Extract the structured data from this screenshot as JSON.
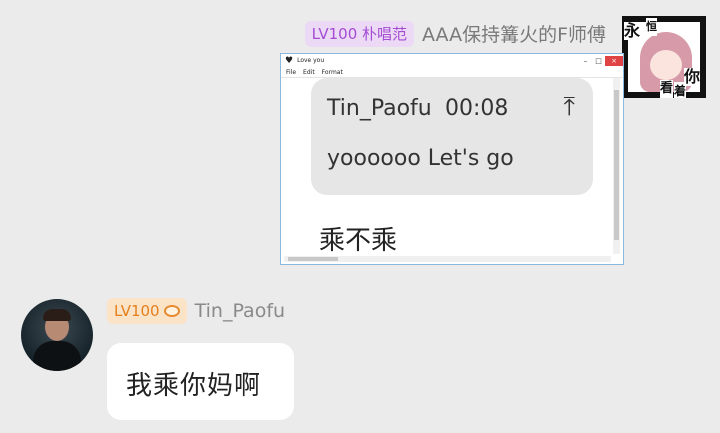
{
  "top_message": {
    "level_badge": "LV100 朴唱范",
    "sender_name": "AAA保持篝火的F师傅",
    "avatar_chars": [
      "永",
      "恒",
      "看",
      "着",
      "你"
    ],
    "window": {
      "title": "Love you",
      "menu": [
        "File",
        "Edit",
        "Format"
      ],
      "controls": [
        "–",
        "□",
        "×"
      ],
      "quote": {
        "user": "Tin_Paofu",
        "time": "00:08",
        "text": "yoooooo Let's go"
      },
      "note": "乘不乘"
    }
  },
  "bottom_message": {
    "level_badge": "LV100",
    "sender_name": "Tin_Paofu",
    "text": "我乘你妈啊"
  },
  "colors": {
    "background": "#ebebeb",
    "badge_purple_bg": "#ecd9f6",
    "badge_purple_fg": "#a44dd3",
    "badge_orange_bg": "#fbe3c8",
    "badge_orange_fg": "#e3801d"
  }
}
